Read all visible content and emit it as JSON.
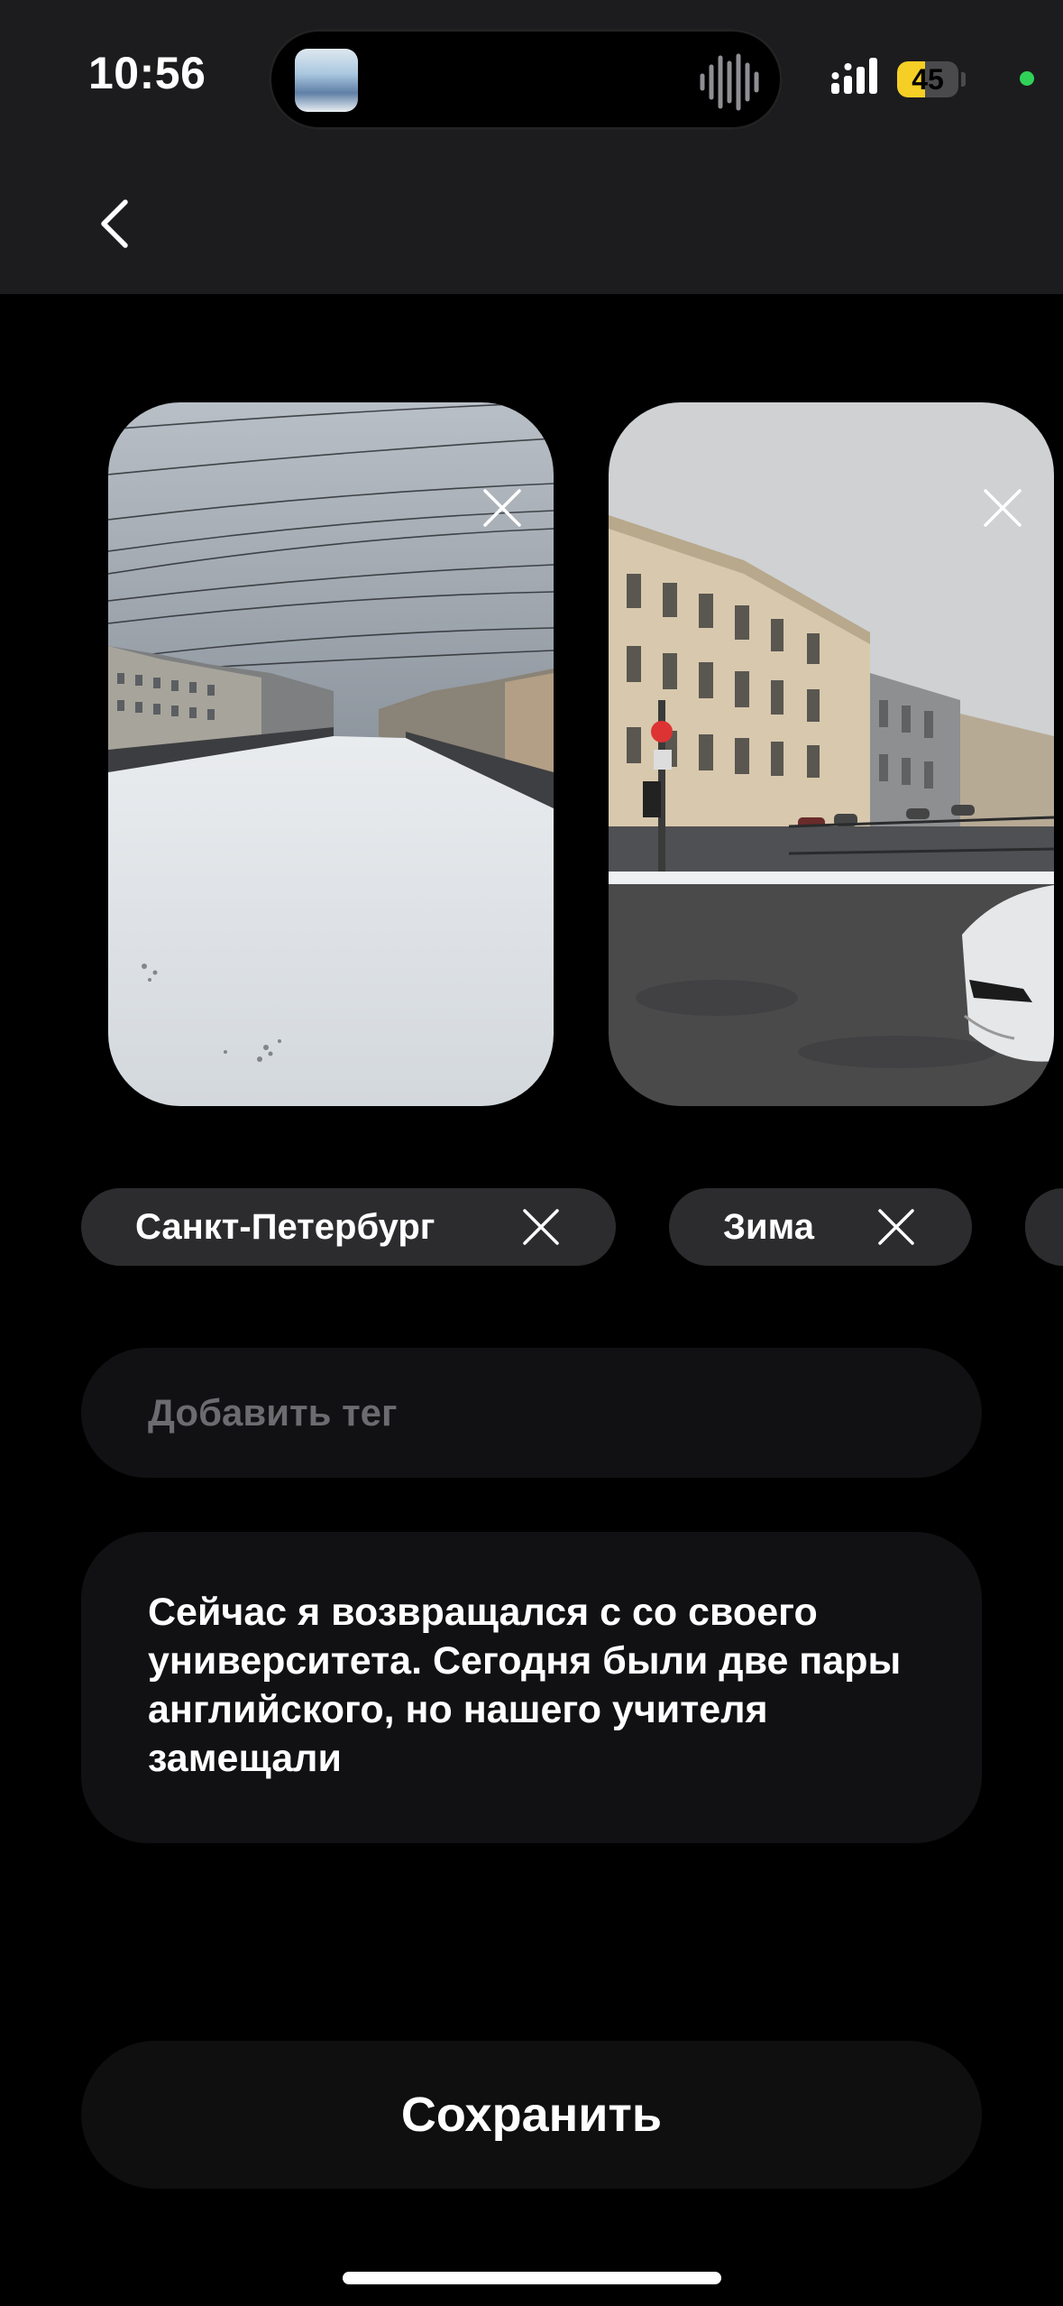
{
  "status_bar": {
    "time": "10:56",
    "battery_level": "45",
    "battery_fraction": 0.45,
    "icons": [
      "island-thumbnail",
      "audio-waveform-icon",
      "cellular-signal-icon",
      "battery-icon",
      "green-privacy-dot"
    ]
  },
  "header": {
    "back_icon": "chevron-left-icon"
  },
  "photos": [
    {
      "description_icon": "photo-frozen-river",
      "remove_icon": "close-icon"
    },
    {
      "description_icon": "photo-city-street",
      "remove_icon": "close-icon"
    }
  ],
  "tags": [
    {
      "label": "Санкт-Петербург",
      "remove_icon": "close-icon"
    },
    {
      "label": "Зима",
      "remove_icon": "close-icon"
    }
  ],
  "tag_input": {
    "placeholder": "Добавить тег",
    "value": ""
  },
  "note": {
    "text": "Сейчас я возвращался с со своего университета. Сегодня были две пары английского, но нашего учителя замещали"
  },
  "save_button": {
    "label": "Сохранить"
  },
  "colors": {
    "background": "#000000",
    "header": "#1c1c1e",
    "chip": "#2c2c2e",
    "field": "#111113",
    "battery": "#f5cf25",
    "privacy_dot": "#30d158"
  }
}
